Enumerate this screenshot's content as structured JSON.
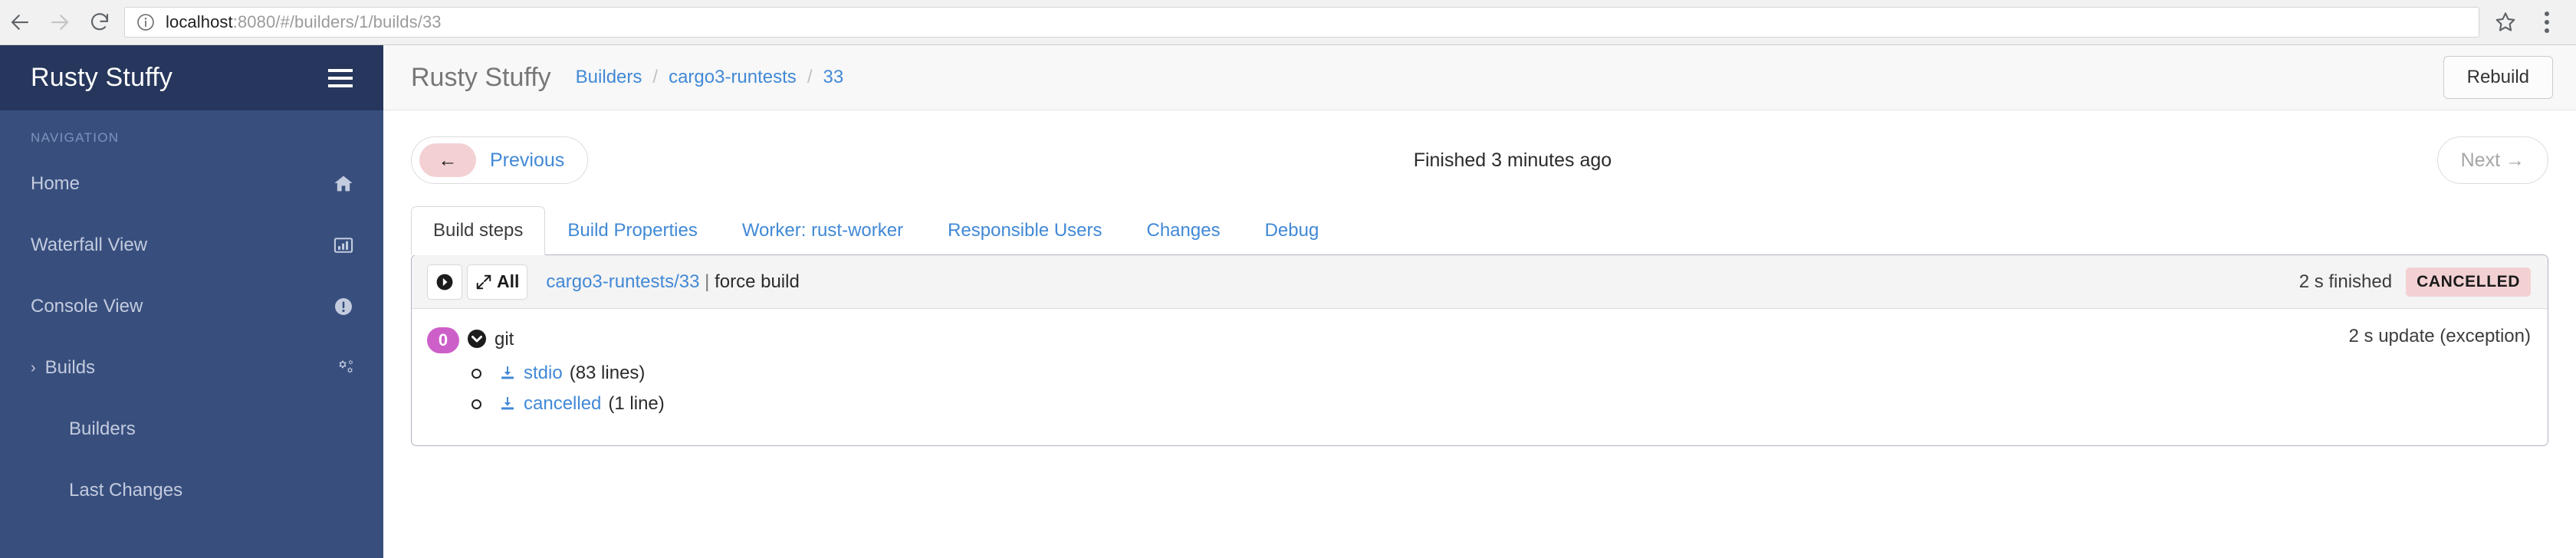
{
  "browser": {
    "back_icon": "back-arrow-icon",
    "forward_icon": "forward-arrow-icon",
    "reload_icon": "reload-icon",
    "info_icon": "info-circle-icon",
    "url_host": "localhost",
    "url_path": ":8080/#/builders/1/builds/33",
    "star_icon": "star-icon",
    "menu_icon": "three-dot-menu-icon"
  },
  "sidebar": {
    "title": "Rusty Stuffy",
    "hamburger_icon": "hamburger-icon",
    "nav_label": "NAVIGATION",
    "items": [
      {
        "label": "Home",
        "icon": "home-icon"
      },
      {
        "label": "Waterfall View",
        "icon": "bar-chart-icon"
      },
      {
        "label": "Console View",
        "icon": "exclamation-circle-icon"
      },
      {
        "label": "Builds",
        "icon": "gears-icon",
        "chevron": "›"
      },
      {
        "label": "Builders",
        "icon": ""
      },
      {
        "label": "Last Changes",
        "icon": ""
      }
    ]
  },
  "header": {
    "app_title": "Rusty Stuffy",
    "breadcrumb": [
      {
        "label": "Builders"
      },
      {
        "label": "cargo3-runtests"
      },
      {
        "label": "33"
      }
    ],
    "separator": "/",
    "rebuild_label": "Rebuild"
  },
  "build_nav": {
    "previous_label": "Previous",
    "previous_arrow": "←",
    "status": "Finished 3 minutes ago",
    "next_label": "Next →"
  },
  "tabs": [
    {
      "label": "Build steps",
      "active": true
    },
    {
      "label": "Build Properties",
      "active": false
    },
    {
      "label": "Worker: rust-worker",
      "active": false
    },
    {
      "label": "Responsible Users",
      "active": false
    },
    {
      "label": "Changes",
      "active": false
    },
    {
      "label": "Debug",
      "active": false
    }
  ],
  "build_summary": {
    "play_icon": "play-circle-icon",
    "expand_icon": "expand-arrows-icon",
    "all_label": "All",
    "builder_link": "cargo3-runtests/33",
    "separator": "|",
    "reason": "force build",
    "duration": "2 s finished",
    "status_badge": "CANCELLED",
    "badge_color": "#f3d1d3"
  },
  "step": {
    "number": "0",
    "toggle_icon": "chevron-down-circle-icon",
    "name": "git",
    "duration": "2 s update (exception)",
    "logs": [
      {
        "download_icon": "download-icon",
        "name": "stdio",
        "lines": "(83 lines)"
      },
      {
        "download_icon": "download-icon",
        "name": "cancelled",
        "lines": "(1 line)"
      }
    ]
  },
  "colors": {
    "sidebar_bg": "#384f7e",
    "sidebar_header_bg": "#26365c",
    "link_blue": "#4189d6",
    "step_number_magenta": "#cd5fc9",
    "cancelled_pink": "#f3d1d3",
    "panel_border": "#b9aec4"
  }
}
